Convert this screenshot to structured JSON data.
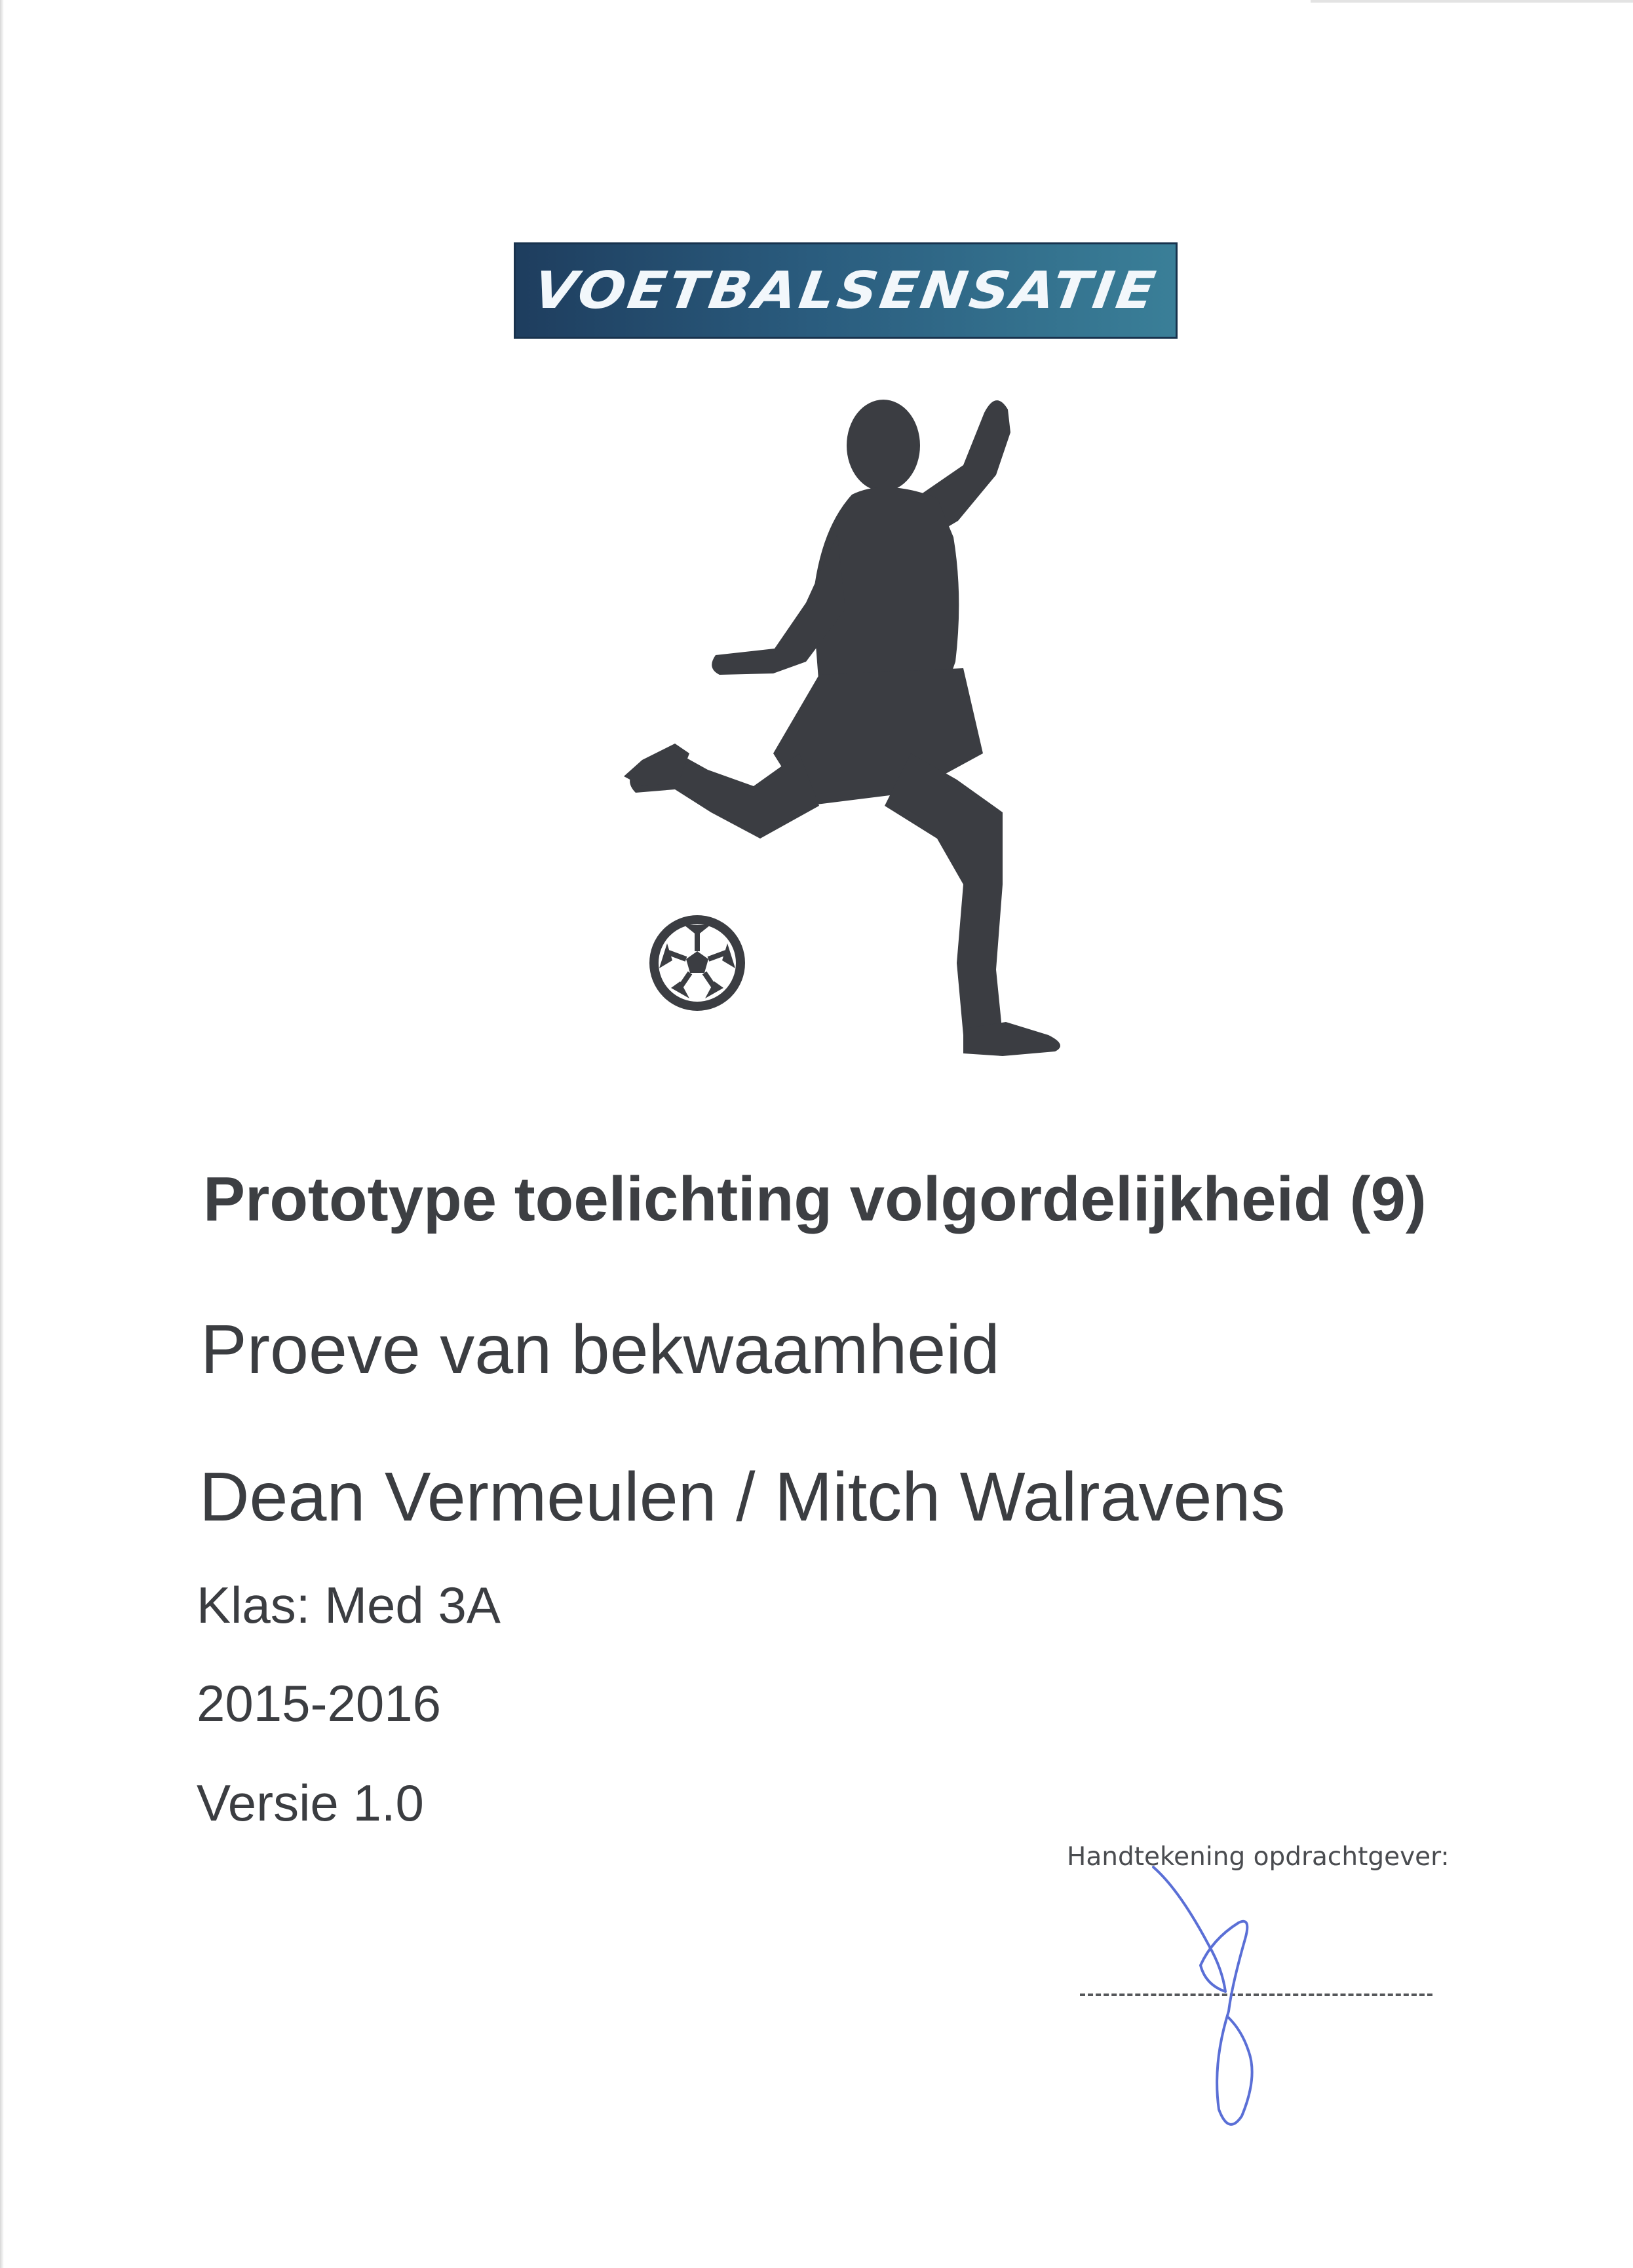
{
  "logo": {
    "text": "VOETBALSENSATIE",
    "colors": [
      "#1e3d5e",
      "#3a7f98"
    ]
  },
  "illustration": {
    "icon": "footballer-kicking-ball-silhouette",
    "color": "#3b3d42"
  },
  "document": {
    "title": "Prototype toelichting volgordelijkheid (9)",
    "subtitle": "Proeve van bekwaamheid",
    "authors": "Dean Vermeulen / Mitch Walravens",
    "class": "Klas: Med 3A",
    "year": "2015-2016",
    "version": "Versie 1.0"
  },
  "signature": {
    "label": "Handtekening opdrachtgever:",
    "ink_color": "#5a6fd6"
  }
}
